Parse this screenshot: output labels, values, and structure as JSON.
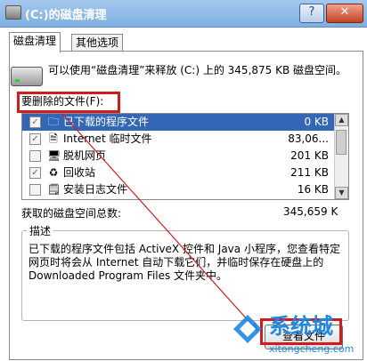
{
  "window": {
    "title": "(C:)的磁盘清理",
    "help_button": "?",
    "close_button": "✕"
  },
  "tabs": [
    {
      "label": "磁盘清理"
    },
    {
      "label": "其他选项"
    }
  ],
  "info": "可以使用“磁盘清理”来释放 (C:) 上的 345,875 KB 磁盘空间。",
  "files_section_label": "要删除的文件(F):",
  "files": [
    {
      "label": "已下载的程序文件",
      "size": "0 KB",
      "checked": true,
      "icon": "folder-icon"
    },
    {
      "label": "Internet 临时文件",
      "size": "83,06...",
      "checked": true,
      "icon": "document-icon"
    },
    {
      "label": "脱机网页",
      "size": "201 KB",
      "checked": false,
      "icon": "offline-page-icon"
    },
    {
      "label": "回收站",
      "size": "211 KB",
      "checked": true,
      "icon": "recycle-bin-icon"
    },
    {
      "label": "安装日志文件",
      "size": "16 KB",
      "checked": false,
      "icon": "log-file-icon"
    }
  ],
  "total": {
    "label": "获取的磁盘空间总数:",
    "value": "345,659 K"
  },
  "description": {
    "title": "描述",
    "text": "已下载的程序文件包括 ActiveX 控件和 Java 小程序，您查看特定网页时将会从 Internet 自动下载它们，并临时保存在硬盘上的 Downloaded Program Files 文件夹中。"
  },
  "view_files_button": "查看文件",
  "watermark": {
    "brand": "系统城",
    "url": "xitongcheng.com"
  },
  "colors": {
    "selection": "#3366b5",
    "annotation": "#d01c1c"
  }
}
